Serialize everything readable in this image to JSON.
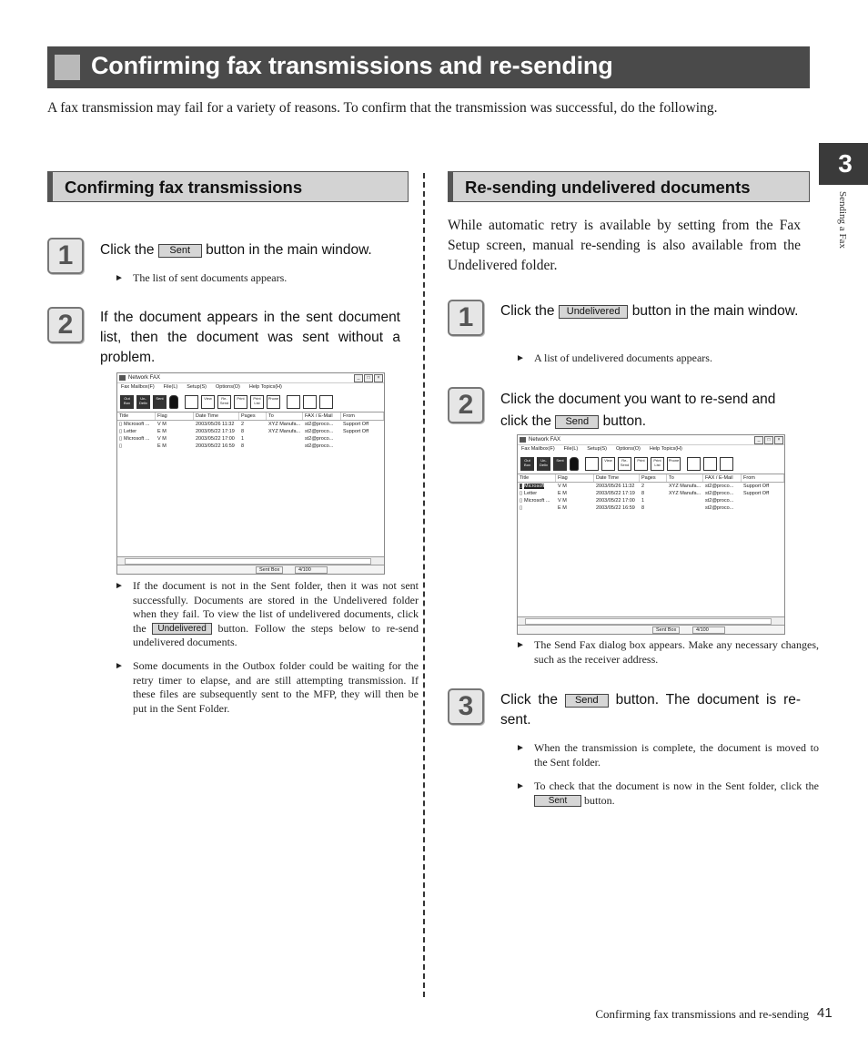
{
  "page": {
    "title": "Confirming fax transmissions and re-sending",
    "intro": "A fax transmission may fail for a variety of reasons. To confirm that the transmission was successful, do the following.",
    "chapter_number": "3",
    "chapter_label": "Sending a Fax",
    "footer_title": "Confirming fax transmissions and re-sending",
    "page_number": "41"
  },
  "left": {
    "heading": "Confirming fax transmissions",
    "steps": [
      {
        "number": "1",
        "text_before": "Click the",
        "button": "Sent",
        "text_after": "button in the main window.",
        "notes": [
          "The list of sent documents appears."
        ]
      },
      {
        "number": "2",
        "text": "If the document appears in the sent document list, then the document was sent without a problem."
      }
    ],
    "after_notes": [
      {
        "before": "If the document is not in the Sent folder, then it was not sent successfully. Documents are stored in the Undelivered folder when they fail. To view the list of undelivered documents, click the",
        "button": "Undelivered",
        "after": "button. Follow the steps below to re-send undelivered documents."
      },
      {
        "text": "Some documents in the Outbox folder could be waiting for the retry timer to elapse, and are still attempting transmission. If these files are subsequently sent to the MFP, they will then be put in the Sent Folder."
      }
    ]
  },
  "right": {
    "heading": "Re-sending undelivered documents",
    "intro": "While automatic retry is available by setting from the Fax Setup screen, manual re-sending is also available from the Undelivered folder.",
    "steps": [
      {
        "number": "1",
        "text_before": "Click the",
        "button": "Undelivered",
        "text_after": "button in the main window.",
        "notes": [
          "A list of undelivered documents appears."
        ]
      },
      {
        "number": "2",
        "text_before": "Click the document you want to re-send and click the",
        "button": "Send",
        "text_after": "button.",
        "notes": [
          "The Send Fax dialog box appears. Make any necessary changes, such as the receiver address."
        ]
      },
      {
        "number": "3",
        "text_before": "Click the",
        "button": "Send",
        "text_after": "button. The document is re-sent.",
        "notes": [
          "When the transmission is complete, the document is moved to the Sent folder."
        ],
        "note_with_button": {
          "before": "To check that the document is now in the Sent folder, click the",
          "button": "Sent",
          "after": "button."
        }
      }
    ]
  },
  "app_window": {
    "title": "Network FAX",
    "menu": [
      "Fax Mailbox(F)",
      "File(L)",
      "Setup(S)",
      "Options(O)",
      "Help Topics(H)"
    ],
    "toolbar": [
      "Out Box",
      "Un-Deliv",
      "Sent",
      "",
      "",
      "View",
      "Re-Send",
      "Print",
      "Print List",
      "Phone",
      "",
      "",
      ""
    ],
    "columns": [
      "Title",
      "Flag",
      "Date   Time",
      "Pages",
      "To",
      "FAX / E-Mail",
      "From"
    ],
    "sent_rows": [
      [
        "Microsoft ...",
        "V    M",
        "2003/05/26 11:32",
        "2",
        "XYZ Manufa...",
        "st2@proco...",
        "Support Off"
      ],
      [
        "Letter",
        "      E  M",
        "2003/05/22 17:19",
        "8",
        "XYZ Manufa...",
        "st2@proco...",
        "Support Off"
      ],
      [
        "Microsoft ...",
        "V    M",
        "2003/05/22 17:00",
        "1",
        "",
        "st2@proco...",
        ""
      ],
      [
        "",
        "      E  M",
        "2003/05/22 16:59",
        "8",
        "",
        "st2@proco...",
        ""
      ]
    ],
    "undelivered_rows": [
      [
        "Microsoft",
        "V    M",
        "2003/05/26 11:32",
        "2",
        "XYZ Manufa...",
        "st2@proco...",
        "Support Off"
      ],
      [
        "Letter",
        "      E  M",
        "2003/05/22 17:19",
        "8",
        "XYZ Manufa...",
        "st2@proco...",
        "Support Off"
      ],
      [
        "Microsoft ...",
        "V    M",
        "2003/05/22 17:00",
        "1",
        "",
        "st2@proco...",
        ""
      ],
      [
        "",
        "      E  M",
        "2003/05/22 16:59",
        "8",
        "",
        "st2@proco...",
        ""
      ]
    ],
    "status_folder": "Sent Box",
    "status_count": "4/100"
  }
}
